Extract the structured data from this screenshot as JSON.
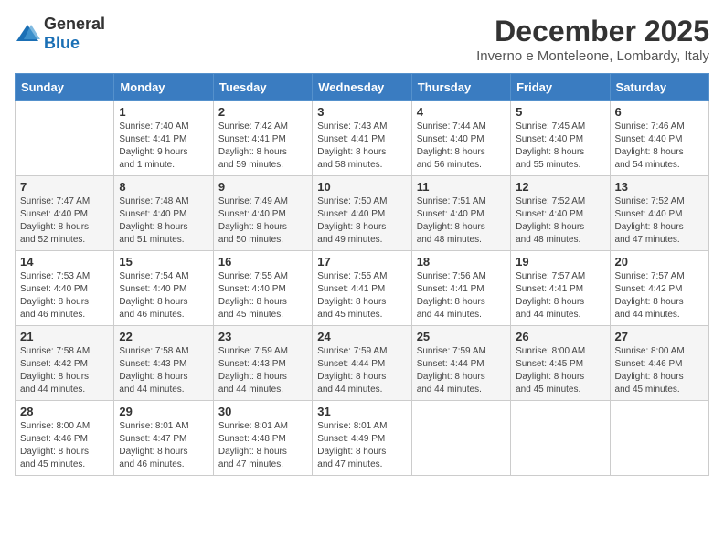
{
  "logo": {
    "general": "General",
    "blue": "Blue"
  },
  "title": "December 2025",
  "location": "Inverno e Monteleone, Lombardy, Italy",
  "headers": [
    "Sunday",
    "Monday",
    "Tuesday",
    "Wednesday",
    "Thursday",
    "Friday",
    "Saturday"
  ],
  "weeks": [
    [
      {
        "day": "",
        "detail": ""
      },
      {
        "day": "1",
        "detail": "Sunrise: 7:40 AM\nSunset: 4:41 PM\nDaylight: 9 hours\nand 1 minute."
      },
      {
        "day": "2",
        "detail": "Sunrise: 7:42 AM\nSunset: 4:41 PM\nDaylight: 8 hours\nand 59 minutes."
      },
      {
        "day": "3",
        "detail": "Sunrise: 7:43 AM\nSunset: 4:41 PM\nDaylight: 8 hours\nand 58 minutes."
      },
      {
        "day": "4",
        "detail": "Sunrise: 7:44 AM\nSunset: 4:40 PM\nDaylight: 8 hours\nand 56 minutes."
      },
      {
        "day": "5",
        "detail": "Sunrise: 7:45 AM\nSunset: 4:40 PM\nDaylight: 8 hours\nand 55 minutes."
      },
      {
        "day": "6",
        "detail": "Sunrise: 7:46 AM\nSunset: 4:40 PM\nDaylight: 8 hours\nand 54 minutes."
      }
    ],
    [
      {
        "day": "7",
        "detail": "Sunrise: 7:47 AM\nSunset: 4:40 PM\nDaylight: 8 hours\nand 52 minutes."
      },
      {
        "day": "8",
        "detail": "Sunrise: 7:48 AM\nSunset: 4:40 PM\nDaylight: 8 hours\nand 51 minutes."
      },
      {
        "day": "9",
        "detail": "Sunrise: 7:49 AM\nSunset: 4:40 PM\nDaylight: 8 hours\nand 50 minutes."
      },
      {
        "day": "10",
        "detail": "Sunrise: 7:50 AM\nSunset: 4:40 PM\nDaylight: 8 hours\nand 49 minutes."
      },
      {
        "day": "11",
        "detail": "Sunrise: 7:51 AM\nSunset: 4:40 PM\nDaylight: 8 hours\nand 48 minutes."
      },
      {
        "day": "12",
        "detail": "Sunrise: 7:52 AM\nSunset: 4:40 PM\nDaylight: 8 hours\nand 48 minutes."
      },
      {
        "day": "13",
        "detail": "Sunrise: 7:52 AM\nSunset: 4:40 PM\nDaylight: 8 hours\nand 47 minutes."
      }
    ],
    [
      {
        "day": "14",
        "detail": "Sunrise: 7:53 AM\nSunset: 4:40 PM\nDaylight: 8 hours\nand 46 minutes."
      },
      {
        "day": "15",
        "detail": "Sunrise: 7:54 AM\nSunset: 4:40 PM\nDaylight: 8 hours\nand 46 minutes."
      },
      {
        "day": "16",
        "detail": "Sunrise: 7:55 AM\nSunset: 4:40 PM\nDaylight: 8 hours\nand 45 minutes."
      },
      {
        "day": "17",
        "detail": "Sunrise: 7:55 AM\nSunset: 4:41 PM\nDaylight: 8 hours\nand 45 minutes."
      },
      {
        "day": "18",
        "detail": "Sunrise: 7:56 AM\nSunset: 4:41 PM\nDaylight: 8 hours\nand 44 minutes."
      },
      {
        "day": "19",
        "detail": "Sunrise: 7:57 AM\nSunset: 4:41 PM\nDaylight: 8 hours\nand 44 minutes."
      },
      {
        "day": "20",
        "detail": "Sunrise: 7:57 AM\nSunset: 4:42 PM\nDaylight: 8 hours\nand 44 minutes."
      }
    ],
    [
      {
        "day": "21",
        "detail": "Sunrise: 7:58 AM\nSunset: 4:42 PM\nDaylight: 8 hours\nand 44 minutes."
      },
      {
        "day": "22",
        "detail": "Sunrise: 7:58 AM\nSunset: 4:43 PM\nDaylight: 8 hours\nand 44 minutes."
      },
      {
        "day": "23",
        "detail": "Sunrise: 7:59 AM\nSunset: 4:43 PM\nDaylight: 8 hours\nand 44 minutes."
      },
      {
        "day": "24",
        "detail": "Sunrise: 7:59 AM\nSunset: 4:44 PM\nDaylight: 8 hours\nand 44 minutes."
      },
      {
        "day": "25",
        "detail": "Sunrise: 7:59 AM\nSunset: 4:44 PM\nDaylight: 8 hours\nand 44 minutes."
      },
      {
        "day": "26",
        "detail": "Sunrise: 8:00 AM\nSunset: 4:45 PM\nDaylight: 8 hours\nand 45 minutes."
      },
      {
        "day": "27",
        "detail": "Sunrise: 8:00 AM\nSunset: 4:46 PM\nDaylight: 8 hours\nand 45 minutes."
      }
    ],
    [
      {
        "day": "28",
        "detail": "Sunrise: 8:00 AM\nSunset: 4:46 PM\nDaylight: 8 hours\nand 45 minutes."
      },
      {
        "day": "29",
        "detail": "Sunrise: 8:01 AM\nSunset: 4:47 PM\nDaylight: 8 hours\nand 46 minutes."
      },
      {
        "day": "30",
        "detail": "Sunrise: 8:01 AM\nSunset: 4:48 PM\nDaylight: 8 hours\nand 47 minutes."
      },
      {
        "day": "31",
        "detail": "Sunrise: 8:01 AM\nSunset: 4:49 PM\nDaylight: 8 hours\nand 47 minutes."
      },
      {
        "day": "",
        "detail": ""
      },
      {
        "day": "",
        "detail": ""
      },
      {
        "day": "",
        "detail": ""
      }
    ]
  ]
}
